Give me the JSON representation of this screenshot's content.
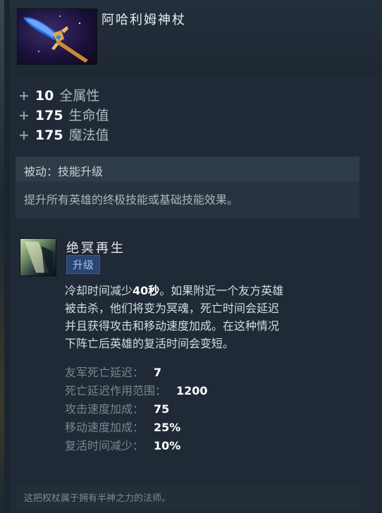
{
  "item": {
    "title": "阿哈利姆神杖"
  },
  "stats": [
    {
      "sign": "+",
      "value": "10",
      "label": "全属性"
    },
    {
      "sign": "+",
      "value": "175",
      "label": "生命值"
    },
    {
      "sign": "+",
      "value": "175",
      "label": "魔法值"
    }
  ],
  "passive": {
    "title": "被动：技能升级",
    "description": "提升所有英雄的终极技能或基础技能效果。"
  },
  "ability": {
    "name": "绝冥再生",
    "badge": "升级",
    "desc_1": "冷却时间减少",
    "desc_value": "40秒",
    "desc_2": "。如果附近一个友方英雄",
    "desc_3": "被击杀，他们将变为冥魂，死亡时间会延迟",
    "desc_4": "并且获得攻击和移动速度加成。在这种情况",
    "desc_5": "下阵亡后英雄的复活时间会变短。",
    "attributes": [
      {
        "label": "友军死亡延迟：",
        "value": "7"
      },
      {
        "label": "死亡延迟作用范围：",
        "value": "1200"
      },
      {
        "label": "攻击速度加成：",
        "value": "75"
      },
      {
        "label": "移动速度加成：",
        "value": "25%"
      },
      {
        "label": "复活时间减少：",
        "value": "10%"
      }
    ]
  },
  "lore": "这把权杖属于拥有半神之力的法师。",
  "colors": {
    "panel": "#1f2a36",
    "badge_bg": "#2c4470",
    "badge_text": "#9fc2ff",
    "value_white": "#ffffff"
  },
  "icons": {
    "item": "scepter-icon",
    "ability": "ability-icon"
  }
}
